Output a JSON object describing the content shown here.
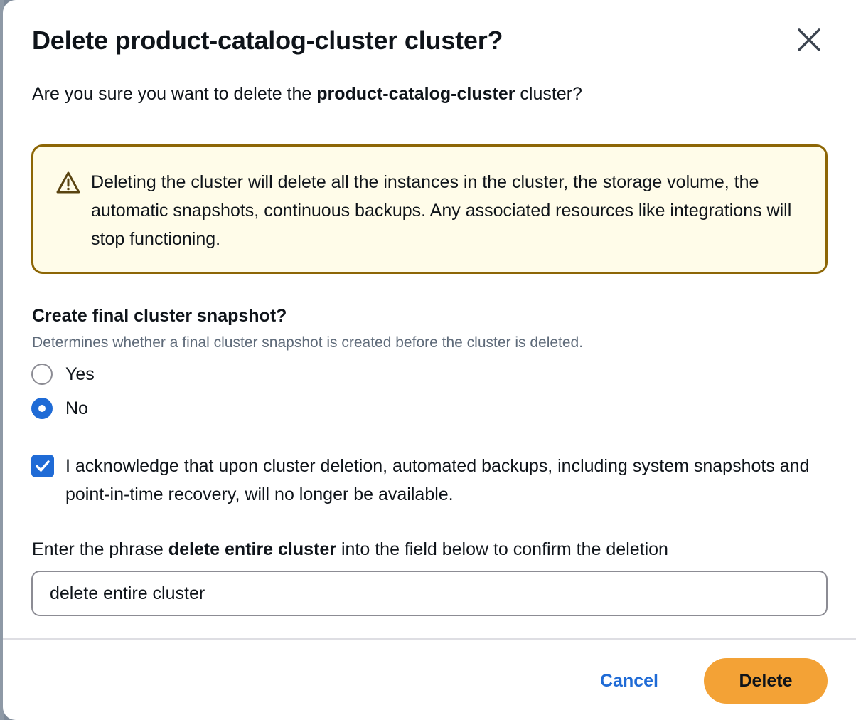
{
  "modal": {
    "title": "Delete product-catalog-cluster cluster?",
    "close_icon": "close-icon"
  },
  "intro": {
    "prefix": "Are you sure you want to delete the ",
    "cluster_name": "product-catalog-cluster",
    "suffix": " cluster?"
  },
  "warning": {
    "icon": "warning-icon",
    "text": "Deleting the cluster will delete all the instances in the cluster, the storage volume, the automatic snapshots, continuous backups. Any associated resources like integrations will stop functioning."
  },
  "final_snapshot": {
    "label": "Create final cluster snapshot?",
    "description": "Determines whether a final cluster snapshot is created before the cluster is deleted.",
    "options": [
      {
        "label": "Yes",
        "selected": false
      },
      {
        "label": "No",
        "selected": true
      }
    ]
  },
  "acknowledge": {
    "checked": true,
    "text": "I acknowledge that upon cluster deletion, automated backups, including system snapshots and point-in-time recovery, will no longer be available."
  },
  "confirm_phrase": {
    "prefix": "Enter the phrase ",
    "phrase": "delete entire cluster",
    "suffix": " into the field below to confirm the deletion",
    "input_value": "delete entire cluster"
  },
  "footer": {
    "cancel_label": "Cancel",
    "delete_label": "Delete"
  },
  "colors": {
    "primary_blue": "#1f6bd6",
    "warning_border": "#8d6605",
    "warning_bg": "#fffce9",
    "delete_button": "#f3a236"
  }
}
